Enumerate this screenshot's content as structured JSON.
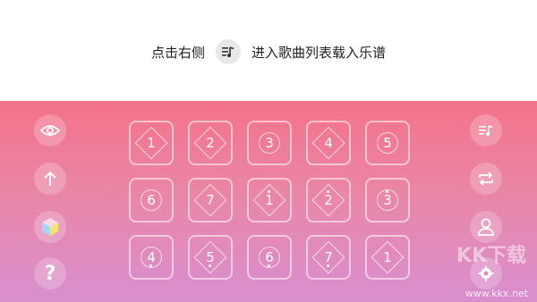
{
  "hint": {
    "left_text": "点击右侧",
    "right_text": "进入歌曲列表载入乐谱",
    "button_icon": "playlist-icon"
  },
  "left_buttons": [
    {
      "icon": "eye-icon"
    },
    {
      "icon": "arrow-up-icon"
    },
    {
      "icon": "cube-icon"
    },
    {
      "icon": "help-icon"
    }
  ],
  "right_buttons": [
    {
      "icon": "playlist-icon"
    },
    {
      "icon": "repeat-icon"
    },
    {
      "icon": "user-icon"
    },
    {
      "icon": "settings-icon"
    }
  ],
  "pads": [
    {
      "label": "1",
      "dot": "none"
    },
    {
      "label": "2",
      "dot": "none"
    },
    {
      "label": "3",
      "dot": "none"
    },
    {
      "label": "4",
      "dot": "none"
    },
    {
      "label": "5",
      "dot": "none"
    },
    {
      "label": "6",
      "dot": "none"
    },
    {
      "label": "7",
      "dot": "none"
    },
    {
      "label": "1",
      "dot": "high"
    },
    {
      "label": "2",
      "dot": "high"
    },
    {
      "label": "3",
      "dot": "high"
    },
    {
      "label": "4",
      "dot": "low"
    },
    {
      "label": "5",
      "dot": "low"
    },
    {
      "label": "6",
      "dot": "low"
    },
    {
      "label": "7",
      "dot": "low"
    },
    {
      "label": "1",
      "dot": "none"
    }
  ],
  "colors": {
    "gradient_top": "#f4728a",
    "gradient_bottom": "#d88fcf"
  },
  "watermark": {
    "big": "KK下载",
    "url": "www.kkx.net"
  }
}
